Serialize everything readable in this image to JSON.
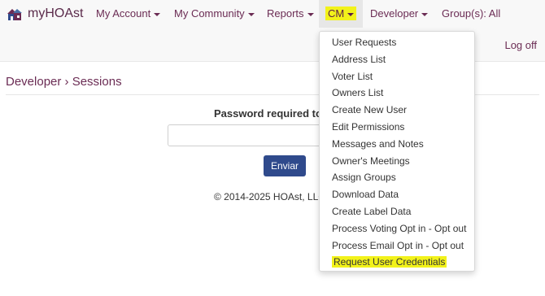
{
  "brand": {
    "name": "myHOAst",
    "logo_icon": "hoa-logo-icon"
  },
  "nav": {
    "items": [
      {
        "label": "My Account"
      },
      {
        "label": "My Community"
      },
      {
        "label": "Reports"
      },
      {
        "label": "CM"
      },
      {
        "label": "Developer"
      },
      {
        "label": "Group(s): All"
      }
    ],
    "logoff": "Log off"
  },
  "breadcrumb": "Developer › Sessions",
  "form": {
    "password_label": "Password required to c",
    "password_value": "",
    "submit_label": "Enviar"
  },
  "footer": {
    "copyright": "© 2014-2025 HOAst, LLC"
  },
  "cm_menu": {
    "items": [
      "User Requests",
      "Address List",
      "Voter List",
      "Owners List",
      "Create New User",
      "Edit Permissions",
      "Messages and Notes",
      "Owner's Meetings",
      "Assign Groups",
      "Download Data",
      "Create Label Data",
      "Process Voting Opt in - Opt out",
      "Process Email Opt in - Opt out",
      "Request User Credentials"
    ],
    "highlighted_index": 13
  },
  "colors": {
    "nav_text": "#6b2c54",
    "highlight": "#f2f21a",
    "button": "#2f4a8c"
  }
}
